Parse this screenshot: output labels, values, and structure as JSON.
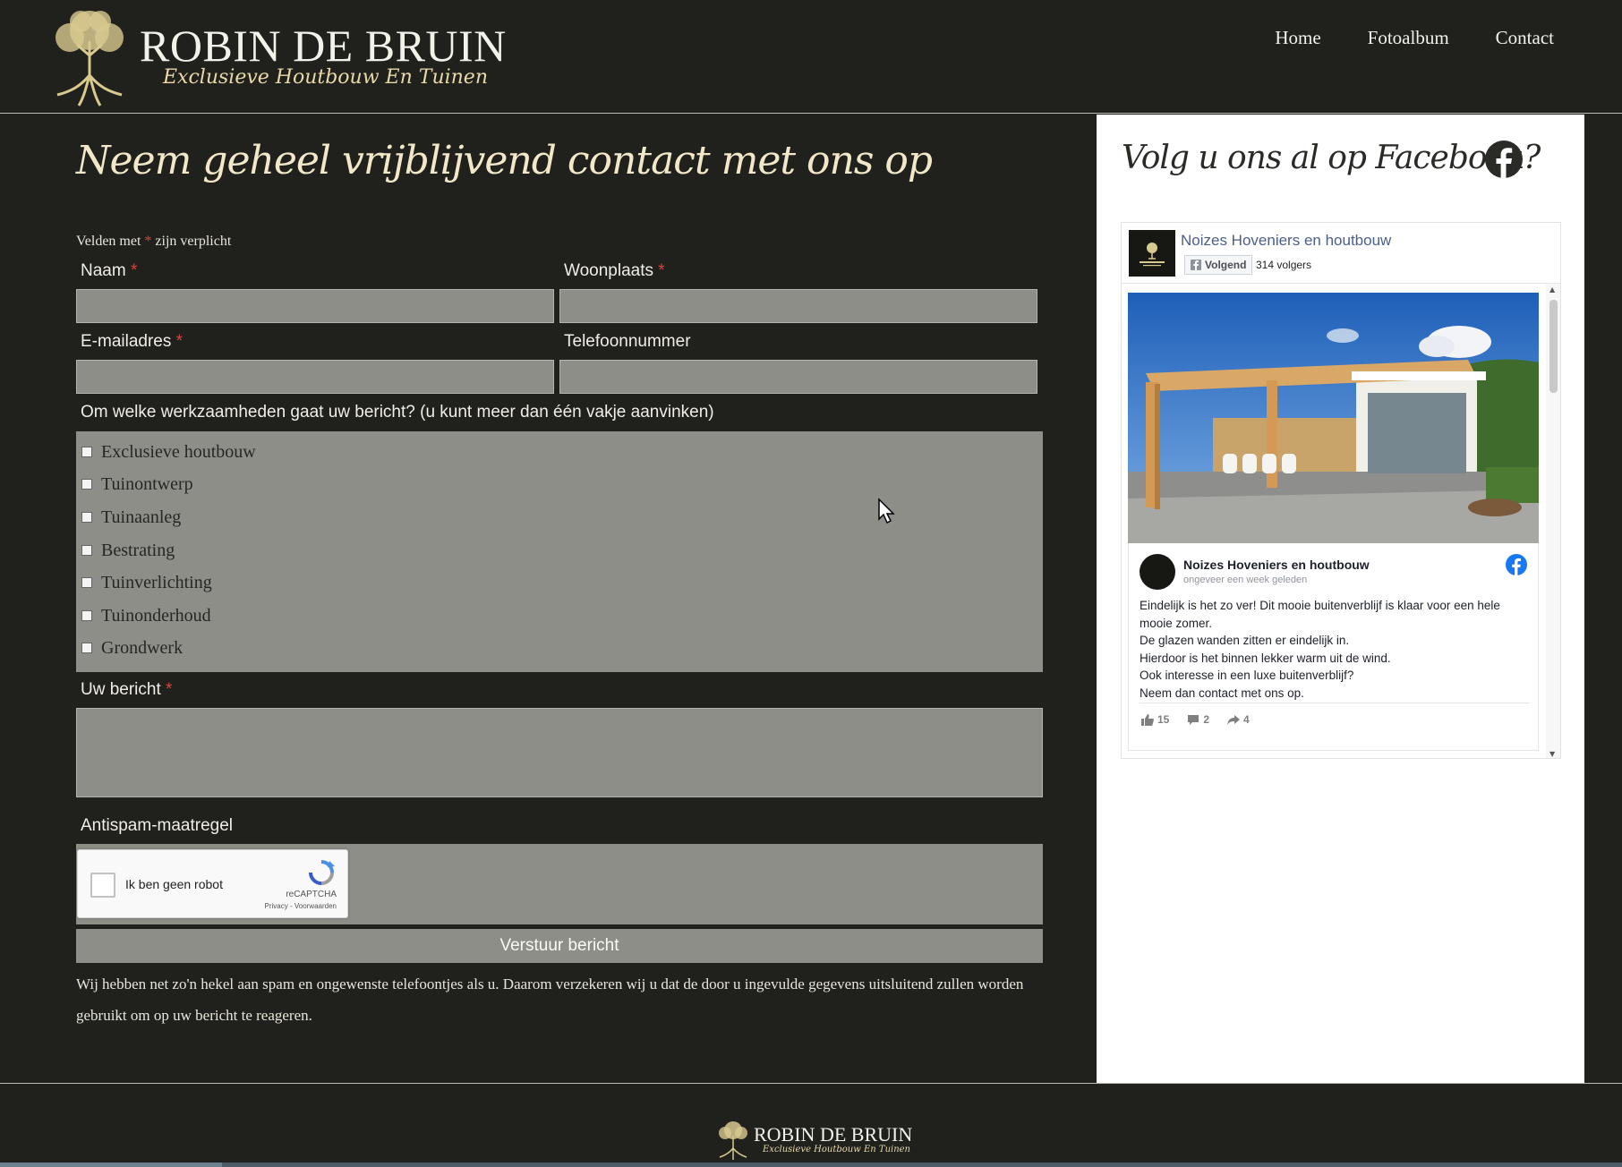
{
  "header": {
    "logo_title": "ROBIN DE BRUIN",
    "logo_subtitle": "Exclusieve Houtbouw En Tuinen",
    "nav": [
      "Home",
      "Fotoalbum",
      "Contact"
    ]
  },
  "form": {
    "title": "Neem geheel vrijblijvend contact met ons op",
    "required_note_prefix": "Velden met ",
    "required_note_star": "*",
    "required_note_suffix": " zijn verplicht",
    "fields": {
      "naam": "Naam",
      "woonplaats": "Woonplaats",
      "email": "E-mailadres",
      "telefoon": "Telefoonnummer"
    },
    "required_star": "*",
    "checkbox_question": "Om welke werkzaamheden gaat uw bericht? (u kunt meer dan één vakje aanvinken)",
    "checkboxes": [
      "Exclusieve houtbouw",
      "Tuinontwerp",
      "Tuinaanleg",
      "Bestrating",
      "Tuinverlichting",
      "Tuinonderhoud",
      "Grondwerk"
    ],
    "message_label": "Uw bericht",
    "antispam_label": "Antispam-maatregel",
    "captcha": {
      "label": "Ik ben geen robot",
      "brand": "reCAPTCHA",
      "links": "Privacy - Voorwaarden"
    },
    "submit_label": "Verstuur bericht",
    "disclaimer": "Wij hebben net zo'n hekel aan spam en ongewenste telefoontjes als u. Daarom verzekeren wij u dat de door u ingevulde gegevens uitsluitend zullen worden gebruikt om op uw bericht te reageren."
  },
  "sidebar": {
    "title": "Volg u ons al op Facebook?",
    "widget": {
      "page_name": "Noizes Hoveniers en houtbouw",
      "follow_label": "Volgend",
      "followers": "314 volgers",
      "post": {
        "author": "Noizes Hoveniers en houtbouw",
        "time": "ongeveer een week geleden",
        "lines": [
          "Eindelijk is het zo ver! Dit mooie buitenverblijf is klaar voor een hele mooie zomer.",
          "De glazen wanden zitten er eindelijk in.",
          "Hierdoor is het binnen lekker warm uit de wind.",
          "Ook interesse in een luxe buitenverblijf?",
          "Neem dan contact met ons op."
        ],
        "likes": "15",
        "comments": "2",
        "shares": "4"
      }
    }
  },
  "footer": {
    "logo_title": "ROBIN DE BRUIN",
    "logo_subtitle": "Exclusieve Houtbouw En Tuinen"
  },
  "colors": {
    "background": "#20201c",
    "field": "#8e8e88",
    "accent_gold": "#e8d9a8",
    "required": "#d9443a",
    "facebook": "#1877f2"
  }
}
